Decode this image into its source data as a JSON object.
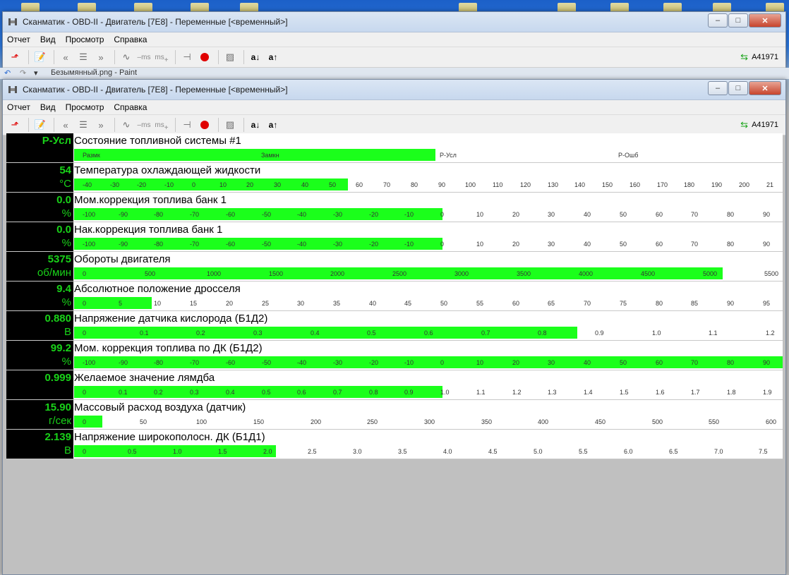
{
  "window1": {
    "title": "Сканматик - OBD-II - Двигатель [7E8] - Переменные [<временный>]",
    "menu": [
      "Отчет",
      "Вид",
      "Просмотр",
      "Справка"
    ],
    "device": "A41971"
  },
  "paint_strip": {
    "title": "Безымянный.png - Paint"
  },
  "window2": {
    "title": "Сканматик - OBD-II - Двигатель [7E8] - Переменные [<временный>]",
    "menu": [
      "Отчет",
      "Вид",
      "Просмотр",
      "Справка"
    ],
    "device": "A41971",
    "toolbar_ms_label": "ms"
  },
  "params": [
    {
      "value": "P-Усл",
      "unit": "",
      "name": "Состояние топливной системы #1",
      "level": 0.51,
      "ticks": [
        "Размк",
        "Замкн",
        "P-Усл",
        "P-Ошб"
      ]
    },
    {
      "value": "54",
      "unit": "°C",
      "name": "Температура охлаждающей жидкости",
      "level": 0.386,
      "ticks": [
        "-40",
        "-30",
        "-20",
        "-10",
        "0",
        "10",
        "20",
        "30",
        "40",
        "50",
        "60",
        "70",
        "80",
        "90",
        "100",
        "110",
        "120",
        "130",
        "140",
        "150",
        "160",
        "170",
        "180",
        "190",
        "200",
        "21"
      ]
    },
    {
      "value": "0.0",
      "unit": "%",
      "name": "Мом.коррекция топлива банк 1",
      "level": 0.52,
      "ticks": [
        "-100",
        "-90",
        "-80",
        "-70",
        "-60",
        "-50",
        "-40",
        "-30",
        "-20",
        "-10",
        "0",
        "10",
        "20",
        "30",
        "40",
        "50",
        "60",
        "70",
        "80",
        "90"
      ]
    },
    {
      "value": "0.0",
      "unit": "%",
      "name": "Нак.коррекция топлива банк 1",
      "level": 0.52,
      "ticks": [
        "-100",
        "-90",
        "-80",
        "-70",
        "-60",
        "-50",
        "-40",
        "-30",
        "-20",
        "-10",
        "0",
        "10",
        "20",
        "30",
        "40",
        "50",
        "60",
        "70",
        "80",
        "90"
      ]
    },
    {
      "value": "5375",
      "unit": "об/мин",
      "name": "Обороты двигателя",
      "level": 0.915,
      "ticks": [
        "0",
        "500",
        "1000",
        "1500",
        "2000",
        "2500",
        "3000",
        "3500",
        "4000",
        "4500",
        "5000",
        "5500"
      ]
    },
    {
      "value": "9.4",
      "unit": "%",
      "name": "Абсолютное положение дросселя",
      "level": 0.11,
      "ticks": [
        "0",
        "5",
        "10",
        "15",
        "20",
        "25",
        "30",
        "35",
        "40",
        "45",
        "50",
        "55",
        "60",
        "65",
        "70",
        "75",
        "80",
        "85",
        "90",
        "95"
      ]
    },
    {
      "value": "0.880",
      "unit": "В",
      "name": "Напряжение датчика кислорода (Б1Д2)",
      "level": 0.71,
      "ticks": [
        "0",
        "0.1",
        "0.2",
        "0.3",
        "0.4",
        "0.5",
        "0.6",
        "0.7",
        "0.8",
        "0.9",
        "1.0",
        "1.1",
        "1.2"
      ]
    },
    {
      "value": "99.2",
      "unit": "%",
      "name": "Мом. коррекция топлива по ДК (Б1Д2)",
      "level": 1.0,
      "ticks": [
        "-100",
        "-90",
        "-80",
        "-70",
        "-60",
        "-50",
        "-40",
        "-30",
        "-20",
        "-10",
        "0",
        "10",
        "20",
        "30",
        "40",
        "50",
        "60",
        "70",
        "80",
        "90"
      ]
    },
    {
      "value": "0.999",
      "unit": "",
      "name": "Желаемое значение лямдба",
      "level": 0.52,
      "ticks": [
        "0",
        "0.1",
        "0.2",
        "0.3",
        "0.4",
        "0.5",
        "0.6",
        "0.7",
        "0.8",
        "0.9",
        "1.0",
        "1.1",
        "1.2",
        "1.3",
        "1.4",
        "1.5",
        "1.6",
        "1.7",
        "1.8",
        "1.9"
      ]
    },
    {
      "value": "15.90",
      "unit": "г/сек",
      "name": "Массовый расход воздуха (датчик)",
      "level": 0.04,
      "ticks": [
        "0",
        "50",
        "100",
        "150",
        "200",
        "250",
        "300",
        "350",
        "400",
        "450",
        "500",
        "550",
        "600"
      ]
    },
    {
      "value": "2.139",
      "unit": "В",
      "name": "Напряжение широкополосн. ДК (Б1Д1)",
      "level": 0.285,
      "ticks": [
        "0",
        "0.5",
        "1.0",
        "1.5",
        "2.0",
        "2.5",
        "3.0",
        "3.5",
        "4.0",
        "4.5",
        "5.0",
        "5.5",
        "6.0",
        "6.5",
        "7.0",
        "7.5"
      ]
    }
  ]
}
